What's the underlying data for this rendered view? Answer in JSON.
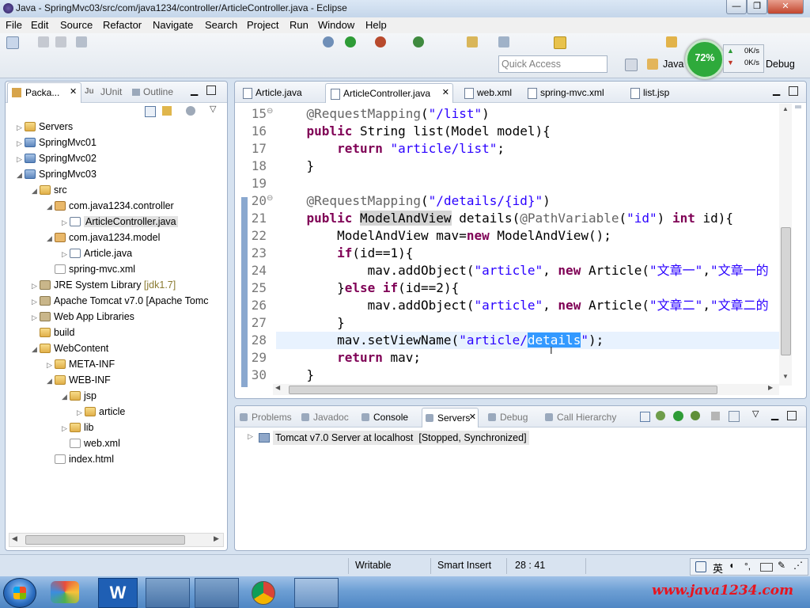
{
  "window": {
    "title": "Java - SpringMvc03/src/com/java1234/controller/ArticleController.java - Eclipse"
  },
  "menu": [
    "File",
    "Edit",
    "Source",
    "Refactor",
    "Navigate",
    "Search",
    "Project",
    "Run",
    "Window",
    "Help"
  ],
  "toolbar": {
    "quick_access_placeholder": "Quick Access",
    "perspective_java": "Java",
    "perspective_debug": "Debug",
    "memory_percent": "72%",
    "net_up": "0K/s",
    "net_down": "0K/s"
  },
  "explorer": {
    "tabs": [
      "Packa...",
      "JUnit",
      "Outline"
    ],
    "tree": [
      {
        "label": "Servers",
        "depth": 0,
        "icon": "folder",
        "arrow": "▷"
      },
      {
        "label": "SpringMvc01",
        "depth": 0,
        "icon": "project",
        "arrow": "▷"
      },
      {
        "label": "SpringMvc02",
        "depth": 0,
        "icon": "project",
        "arrow": "▷"
      },
      {
        "label": "SpringMvc03",
        "depth": 0,
        "icon": "project",
        "arrow": "◢"
      },
      {
        "label": "src",
        "depth": 1,
        "icon": "folder",
        "arrow": "◢"
      },
      {
        "label": "com.java1234.controller",
        "depth": 2,
        "icon": "pkg",
        "arrow": "◢"
      },
      {
        "label": "ArticleController.java",
        "depth": 3,
        "icon": "java",
        "arrow": "▷",
        "selected": true
      },
      {
        "label": "com.java1234.model",
        "depth": 2,
        "icon": "pkg",
        "arrow": "◢"
      },
      {
        "label": "Article.java",
        "depth": 3,
        "icon": "java",
        "arrow": "▷"
      },
      {
        "label": "spring-mvc.xml",
        "depth": 2,
        "icon": "xml",
        "arrow": ""
      },
      {
        "label": "JRE System Library",
        "depth": 1,
        "icon": "lib",
        "arrow": "▷",
        "suffix": " [jdk1.7]"
      },
      {
        "label": "Apache Tomcat v7.0 [Apache Tomc",
        "depth": 1,
        "icon": "lib",
        "arrow": "▷"
      },
      {
        "label": "Web App Libraries",
        "depth": 1,
        "icon": "lib",
        "arrow": "▷"
      },
      {
        "label": "build",
        "depth": 1,
        "icon": "folder",
        "arrow": ""
      },
      {
        "label": "WebContent",
        "depth": 1,
        "icon": "folder",
        "arrow": "◢"
      },
      {
        "label": "META-INF",
        "depth": 2,
        "icon": "folder",
        "arrow": "▷"
      },
      {
        "label": "WEB-INF",
        "depth": 2,
        "icon": "folder",
        "arrow": "◢"
      },
      {
        "label": "jsp",
        "depth": 3,
        "icon": "folder",
        "arrow": "◢"
      },
      {
        "label": "article",
        "depth": 4,
        "icon": "folder",
        "arrow": "▷"
      },
      {
        "label": "lib",
        "depth": 3,
        "icon": "folder",
        "arrow": "▷"
      },
      {
        "label": "web.xml",
        "depth": 3,
        "icon": "xml",
        "arrow": ""
      },
      {
        "label": "index.html",
        "depth": 2,
        "icon": "xml",
        "arrow": ""
      }
    ]
  },
  "editor": {
    "tabs": [
      "Article.java",
      "ArticleController.java",
      "web.xml",
      "spring-mvc.xml",
      "list.jsp"
    ],
    "active_tab": 1,
    "lines": [
      {
        "n": "15",
        "fold": "⊖",
        "html": "    <span class=\"ann\">@RequestMapping</span>(<span class=\"str\">\"/list\"</span>)"
      },
      {
        "n": "16",
        "html": "    <span class=\"kw\">public</span> String list(Model model){"
      },
      {
        "n": "17",
        "html": "        <span class=\"kw\">return</span> <span class=\"str\">\"article/list\"</span>;"
      },
      {
        "n": "18",
        "html": "    }"
      },
      {
        "n": "19",
        "html": ""
      },
      {
        "n": "20",
        "fold": "⊖",
        "html": "    <span class=\"ann\">@RequestMapping</span>(<span class=\"str\">\"/details/{id}\"</span>)"
      },
      {
        "n": "21",
        "html": "    <span class=\"kw\">public</span> <span style=\"background:#d4d4d4\">ModelAndView</span> details(<span class=\"ann\">@PathVariable</span>(<span class=\"str\">\"id\"</span>) <span class=\"kw\">int</span> id){"
      },
      {
        "n": "22",
        "html": "        ModelAndView mav=<span class=\"kw\">new</span> ModelAndView();"
      },
      {
        "n": "23",
        "html": "        <span class=\"kw\">if</span>(id==1){"
      },
      {
        "n": "24",
        "html": "            mav.addObject(<span class=\"str\">\"article\"</span>, <span class=\"kw\">new</span> Article(<span class=\"str\">\"文章一\"</span>,<span class=\"str\">\"文章一的"
      },
      {
        "n": "25",
        "html": "        }<span class=\"kw\">else</span> <span class=\"kw\">if</span>(id==2){"
      },
      {
        "n": "26",
        "html": "            mav.addObject(<span class=\"str\">\"article\"</span>, <span class=\"kw\">new</span> Article(<span class=\"str\">\"文章二\"</span>,<span class=\"str\">\"文章二的"
      },
      {
        "n": "27",
        "html": "        }"
      },
      {
        "n": "28",
        "current": true,
        "html": "        mav.setViewName(<span class=\"str\">\"article/<span style=\"background:#3399ff;color:#fff\">details</span>\"</span>);"
      },
      {
        "n": "29",
        "html": "        <span class=\"kw\">return</span> mav;"
      },
      {
        "n": "30",
        "html": "    }"
      }
    ]
  },
  "bottom": {
    "tabs": [
      "Problems",
      "Javadoc",
      "Console",
      "Servers",
      "Debug",
      "Call Hierarchy"
    ],
    "active_tab": 3,
    "server_entry": "Tomcat v7.0 Server at localhost",
    "server_status": "[Stopped, Synchronized]"
  },
  "status": {
    "writable": "Writable",
    "insert_mode": "Smart Insert",
    "position": "28 : 41"
  },
  "ime": {
    "lang": "英"
  },
  "watermark": "www.java1234.com",
  "colors": {
    "keyword": "#7f0055",
    "string": "#2a00ff",
    "annotation": "#646464",
    "selection": "#3399ff",
    "memory_ring": "#2eaa3b"
  }
}
